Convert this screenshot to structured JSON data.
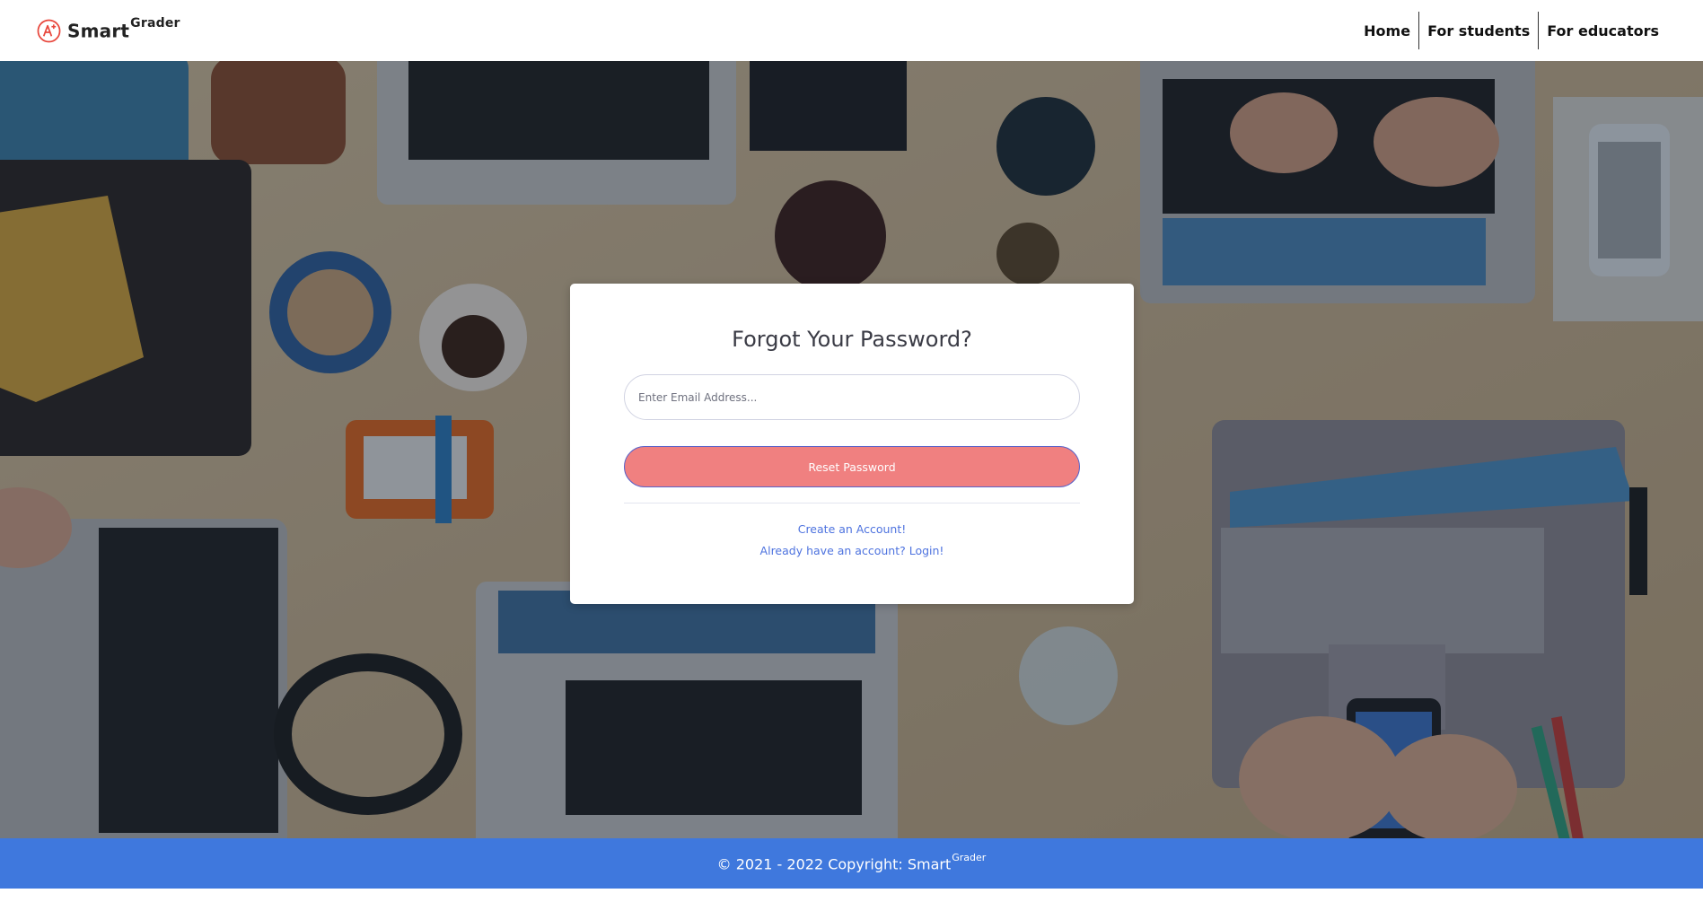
{
  "brand": {
    "name": "Smart",
    "superscript": "Grader",
    "logo_icon": "a-plus-grade-icon",
    "logo_color": "#e8473c"
  },
  "nav": {
    "items": [
      {
        "label": "Home"
      },
      {
        "label": "For students"
      },
      {
        "label": "For educators"
      }
    ]
  },
  "hero": {
    "background": "photo of a wooden desk with laptops, coffee, headphones and phones (darkened overlay)"
  },
  "form": {
    "title": "Forgot Your Password?",
    "email_placeholder": "Enter Email Address...",
    "email_value": "",
    "submit_label": "Reset Password",
    "create_account_link": "Create an Account!",
    "login_link": "Already have an account? Login!"
  },
  "footer": {
    "copyright": "© 2021 - 2022 Copyright: Smart",
    "superscript": "Grader"
  },
  "colors": {
    "accent_button": "#f08080",
    "button_border": "#5a62c8",
    "link": "#4e73df",
    "footer_bg": "#3f78dd"
  }
}
